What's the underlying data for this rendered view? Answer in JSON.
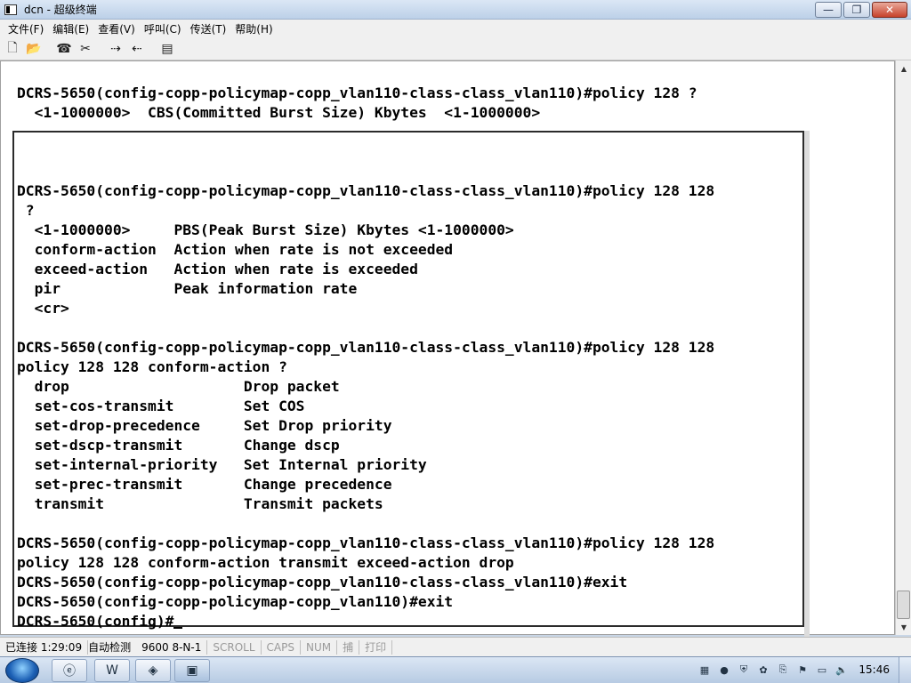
{
  "window": {
    "title": "dcn - 超级终端",
    "buttons": {
      "minimize": "—",
      "maximize": "❐",
      "close": "✕"
    }
  },
  "menu": [
    "文件(F)",
    "编辑(E)",
    "查看(V)",
    "呼叫(C)",
    "传送(T)",
    "帮助(H)"
  ],
  "toolbar": {
    "icons": [
      "new-file-icon",
      "open-folder-icon",
      "phone-icon",
      "disconnect-icon",
      "send-icon",
      "receive-icon",
      "properties-icon"
    ]
  },
  "terminal": {
    "top_lines": [
      "DCRS-5650(config-copp-policymap-copp_vlan110-class-class_vlan110)#policy 128 ?",
      "  <1-1000000>  CBS(Committed Burst Size) Kbytes  <1-1000000>"
    ],
    "lines": [
      "",
      "DCRS-5650(config-copp-policymap-copp_vlan110-class-class_vlan110)#policy 128 128",
      " ?",
      "  <1-1000000>     PBS(Peak Burst Size) Kbytes <1-1000000>",
      "  conform-action  Action when rate is not exceeded",
      "  exceed-action   Action when rate is exceeded",
      "  pir             Peak information rate",
      "  <cr>",
      "",
      "DCRS-5650(config-copp-policymap-copp_vlan110-class-class_vlan110)#policy 128 128",
      "policy 128 128 conform-action ?",
      "  drop                    Drop packet",
      "  set-cos-transmit        Set COS",
      "  set-drop-precedence     Set Drop priority",
      "  set-dscp-transmit       Change dscp",
      "  set-internal-priority   Set Internal priority",
      "  set-prec-transmit       Change precedence",
      "  transmit                Transmit packets",
      "",
      "DCRS-5650(config-copp-policymap-copp_vlan110-class-class_vlan110)#policy 128 128",
      "policy 128 128 conform-action transmit exceed-action drop",
      "DCRS-5650(config-copp-policymap-copp_vlan110-class-class_vlan110)#exit",
      "DCRS-5650(config-copp-policymap-copp_vlan110)#exit",
      "DCRS-5650(config)#"
    ]
  },
  "statusbar": {
    "connection": "已连接 1:29:09",
    "detect": "自动检测",
    "params": "9600 8-N-1",
    "scroll": "SCROLL",
    "caps": "CAPS",
    "num": "NUM",
    "capture": "捕",
    "print": "打印"
  },
  "taskbar": {
    "clock": "15:46"
  }
}
